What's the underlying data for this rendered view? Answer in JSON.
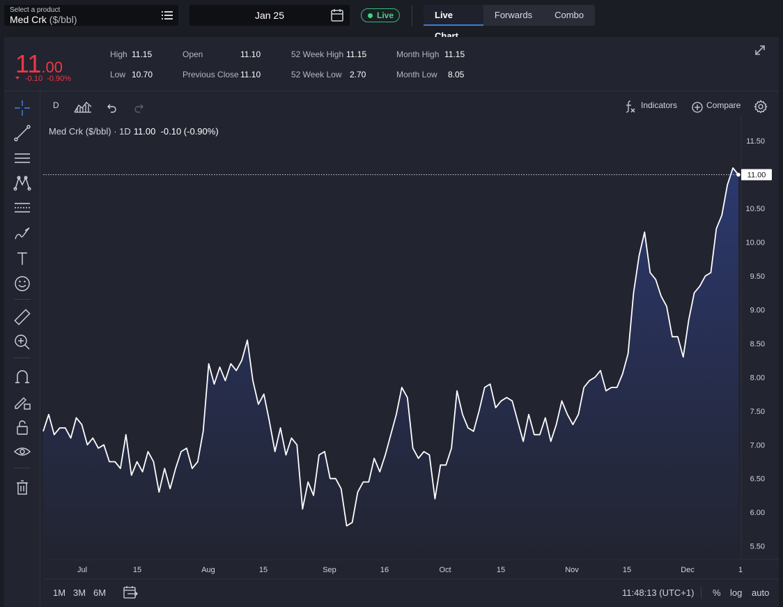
{
  "product": {
    "caption": "Select a product",
    "name": "Med Crk",
    "unit": "($/bbl)"
  },
  "date": {
    "value": "Jan 25"
  },
  "live": {
    "label": "Live"
  },
  "tabs": [
    "Live Chart",
    "Forwards",
    "Combo"
  ],
  "quote": {
    "price_int": "11",
    "price_dec": ".00",
    "change": "-0.10",
    "change_pct": "-0.90%",
    "stats": [
      {
        "key": "High",
        "value": "11.15"
      },
      {
        "key": "Low",
        "value": "10.70"
      },
      {
        "key": "Open",
        "value": "11.10"
      },
      {
        "key": "Previous Close",
        "value": "11.10"
      },
      {
        "key": "52 Week High",
        "value": "11.15"
      },
      {
        "key": "52 Week Low",
        "value": "2.70"
      },
      {
        "key": "Month High",
        "value": "11.15"
      },
      {
        "key": "Month Low",
        "value": "8.05"
      }
    ]
  },
  "chart_toolbar": {
    "interval": "D",
    "indicators_label": "Indicators",
    "compare_label": "Compare"
  },
  "legend": {
    "title": "Med Crk ($/bbl) · 1D",
    "value": "11.00",
    "change": "-0.10 (-0.90%)"
  },
  "bottom": {
    "ranges": [
      "1M",
      "3M",
      "6M"
    ],
    "time": "11:48:13 (UTC+1)",
    "percent": "%",
    "log": "log",
    "auto": "auto"
  },
  "colors": {
    "down": "#f23645",
    "line": "#ffffff",
    "fill_top": "#2c3a72",
    "fill_bottom": "#222430",
    "live": "#3dd67e",
    "accent": "#3f7bd6"
  },
  "chart_data": {
    "type": "area",
    "x_tick_labels": [
      "Jul",
      "15",
      "Aug",
      "15",
      "Sep",
      "16",
      "Oct",
      "15",
      "Nov",
      "15",
      "Dec",
      "1"
    ],
    "y_tick_labels": [
      "11.50",
      "11.00",
      "10.50",
      "10.00",
      "9.50",
      "9.00",
      "8.50",
      "8.00",
      "7.50",
      "7.00",
      "6.50",
      "6.00",
      "5.50"
    ],
    "ylim": [
      5.3,
      11.75
    ],
    "last_value_label": "11.00",
    "values": [
      7.2,
      7.45,
      7.15,
      7.25,
      7.25,
      7.1,
      7.4,
      7.3,
      7.0,
      7.1,
      6.95,
      7.0,
      6.75,
      6.75,
      6.65,
      7.15,
      6.55,
      6.75,
      6.6,
      6.9,
      6.75,
      6.3,
      6.65,
      6.35,
      6.65,
      6.9,
      6.95,
      6.65,
      6.75,
      7.2,
      8.2,
      7.9,
      8.15,
      7.95,
      8.2,
      8.1,
      8.25,
      8.55,
      7.95,
      7.6,
      7.75,
      7.35,
      6.9,
      7.25,
      6.85,
      7.1,
      7.0,
      6.05,
      6.45,
      6.25,
      6.85,
      6.9,
      6.5,
      6.5,
      6.35,
      5.8,
      5.85,
      6.3,
      6.45,
      6.45,
      6.8,
      6.6,
      6.85,
      7.15,
      7.45,
      7.85,
      7.7,
      6.95,
      6.8,
      6.9,
      6.85,
      6.2,
      6.7,
      6.7,
      6.95,
      7.8,
      7.45,
      7.25,
      7.2,
      7.5,
      7.85,
      7.9,
      7.55,
      7.65,
      7.7,
      7.65,
      7.35,
      7.05,
      7.45,
      7.15,
      7.15,
      7.4,
      7.05,
      7.3,
      7.65,
      7.45,
      7.3,
      7.45,
      7.85,
      7.95,
      8.0,
      8.1,
      7.8,
      7.85,
      7.85,
      8.05,
      8.35,
      9.25,
      9.8,
      10.15,
      9.55,
      9.45,
      9.2,
      9.05,
      8.6,
      8.6,
      8.3,
      8.85,
      9.25,
      9.35,
      9.5,
      9.55,
      10.2,
      10.4,
      10.85,
      11.1,
      11.0
    ]
  }
}
